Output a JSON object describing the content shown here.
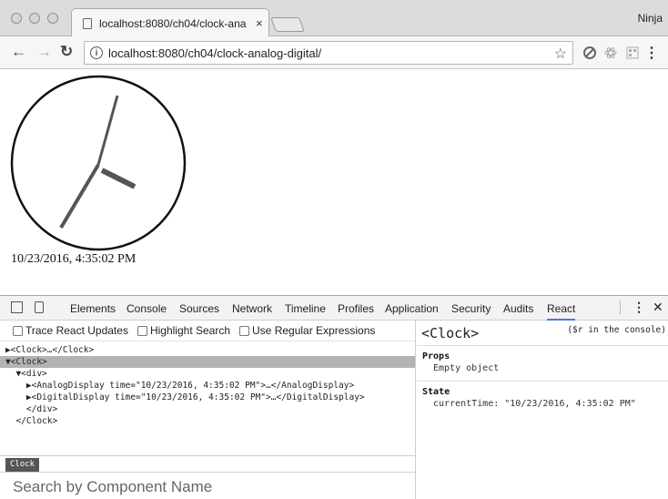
{
  "browser": {
    "tab_title": "localhost:8080/ch04/clock-ana",
    "tab_close": "×",
    "profile": "Ninja",
    "url": "localhost:8080/ch04/clock-analog-digital/"
  },
  "page": {
    "digital_time": "10/23/2016, 4:35:02 PM"
  },
  "devtools": {
    "tabs": [
      "Elements",
      "Console",
      "Sources",
      "Network",
      "Timeline",
      "Profiles",
      "Application",
      "Security",
      "Audits",
      "React"
    ],
    "active_tab": "React",
    "kebab": "⋮",
    "close": "✕",
    "options": [
      "Trace React Updates",
      "Highlight Search",
      "Use Regular Expressions"
    ],
    "tree": [
      "▶<Clock>…</Clock>",
      "▼<Clock>",
      "  ▼<div>",
      "    ▶<AnalogDisplay time=\"10/23/2016, 4:35:02 PM\">…</AnalogDisplay>",
      "    ▶<DigitalDisplay time=\"10/23/2016, 4:35:02 PM\">…</DigitalDisplay>",
      "    </div>",
      "  </Clock>"
    ],
    "breadcrumb": "Clock",
    "search_placeholder": "Search by Component Name",
    "inspector": {
      "title": "<Clock>",
      "hint": "($r in the console)",
      "props_header": "Props",
      "props_value": "Empty object",
      "state_header": "State",
      "state_value": "currentTime: \"10/23/2016, 4:35:02 PM\""
    }
  }
}
